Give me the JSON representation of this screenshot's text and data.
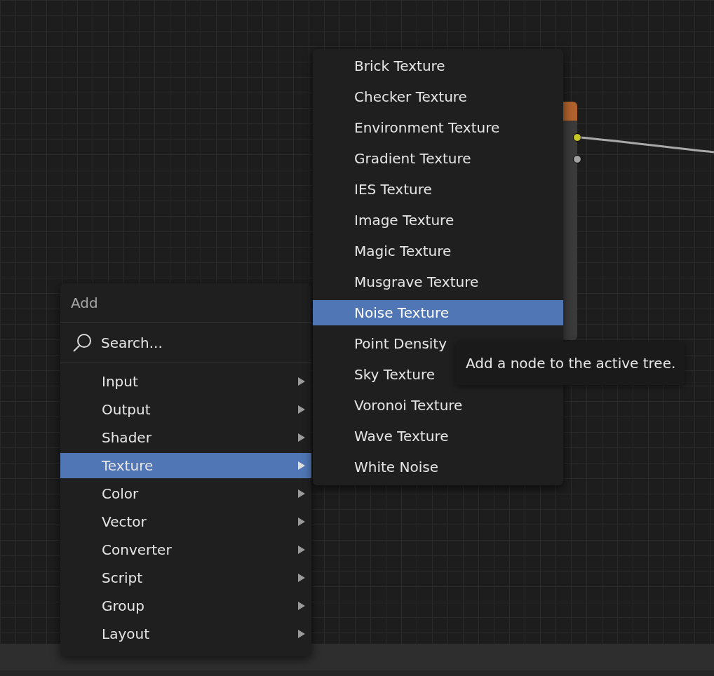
{
  "menu": {
    "title": "Add",
    "search": {
      "label": "Search..."
    },
    "items": [
      {
        "label": "Input",
        "selected": false
      },
      {
        "label": "Output",
        "selected": false
      },
      {
        "label": "Shader",
        "selected": false
      },
      {
        "label": "Texture",
        "selected": true
      },
      {
        "label": "Color",
        "selected": false
      },
      {
        "label": "Vector",
        "selected": false
      },
      {
        "label": "Converter",
        "selected": false
      },
      {
        "label": "Script",
        "selected": false
      },
      {
        "label": "Group",
        "selected": false
      },
      {
        "label": "Layout",
        "selected": false
      }
    ]
  },
  "submenu": {
    "items": [
      {
        "label": "Brick Texture",
        "selected": false
      },
      {
        "label": "Checker Texture",
        "selected": false
      },
      {
        "label": "Environment Texture",
        "selected": false
      },
      {
        "label": "Gradient Texture",
        "selected": false
      },
      {
        "label": "IES Texture",
        "selected": false
      },
      {
        "label": "Image Texture",
        "selected": false
      },
      {
        "label": "Magic Texture",
        "selected": false
      },
      {
        "label": "Musgrave Texture",
        "selected": false
      },
      {
        "label": "Noise Texture",
        "selected": true
      },
      {
        "label": "Point Density",
        "selected": false
      },
      {
        "label": "Sky Texture",
        "selected": false
      },
      {
        "label": "Voronoi Texture",
        "selected": false
      },
      {
        "label": "Wave Texture",
        "selected": false
      },
      {
        "label": "White Noise",
        "selected": false
      }
    ]
  },
  "tooltip": {
    "text": "Add a node to the active tree."
  }
}
